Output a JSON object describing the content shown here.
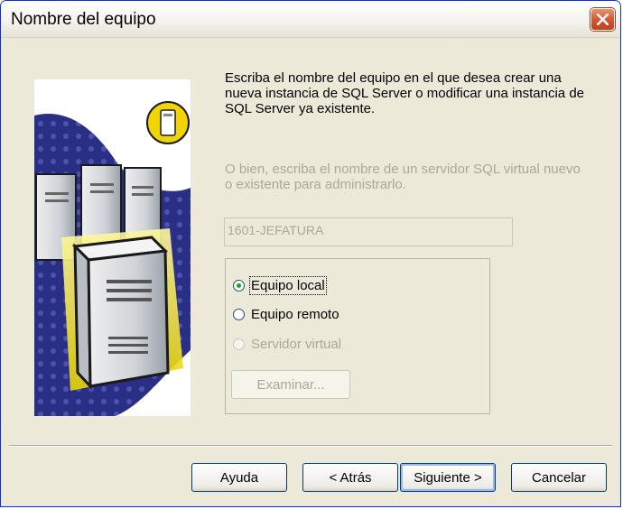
{
  "window": {
    "title": "Nombre del equipo"
  },
  "intro_text": "Escriba el nombre del equipo en el que desea crear una nueva instancia de SQL Server o modificar una instancia de SQL Server ya existente.",
  "alt_text": "O bien, escriba el nombre de un servidor SQL virtual nuevo o existente para administrarlo.",
  "server_name": {
    "value": "1601-JEFATURA"
  },
  "options": [
    {
      "label": "Equipo local",
      "selected": true,
      "enabled": true
    },
    {
      "label": "Equipo remoto",
      "selected": false,
      "enabled": true
    },
    {
      "label": "Servidor virtual",
      "selected": false,
      "enabled": false
    }
  ],
  "browse_button": "Examinar...",
  "buttons": {
    "help": "Ayuda",
    "back": "< Atrás",
    "next": "Siguiente >",
    "cancel": "Cancelar"
  }
}
